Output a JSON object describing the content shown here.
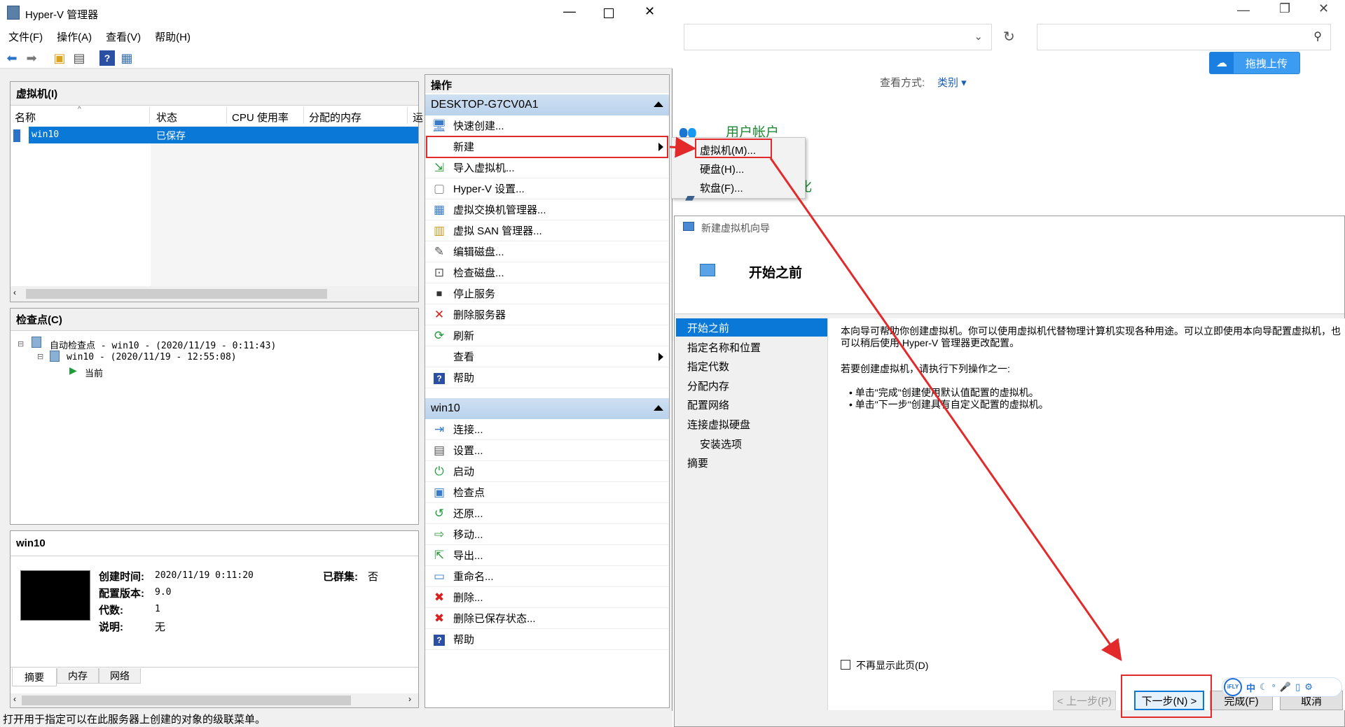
{
  "colors": {
    "selection": "#0a78d7",
    "annotation_red": "#e32a2a",
    "section_bar": "#c7dcf1",
    "upload_blue": "#3b9cf2"
  },
  "hyperv": {
    "title": "Hyper-V 管理器",
    "menu": [
      "文件(F)",
      "操作(A)",
      "查看(V)",
      "帮助(H)"
    ],
    "vm_panel": {
      "header": "虚拟机(I)",
      "columns": [
        "名称",
        "状态",
        "CPU 使用率",
        "分配的内存",
        "运"
      ],
      "rows": [
        {
          "name": "win10",
          "state": "已保存"
        }
      ]
    },
    "checkpoint_panel": {
      "header": "检查点(C)",
      "items": [
        "自动检查点 - win10 - (2020/11/19 - 0:11:43)",
        "win10 - (2020/11/19 - 12:55:08)",
        "当前"
      ]
    },
    "details_panel": {
      "header": "win10",
      "created_label": "创建时间:",
      "created_value": "2020/11/19 0:11:20",
      "clustered_label": "已群集:",
      "clustered_value": "否",
      "config_label": "配置版本:",
      "config_value": "9.0",
      "gen_label": "代数:",
      "gen_value": "1",
      "note_label": "说明:",
      "note_value": "无",
      "tabs": [
        "摘要",
        "内存",
        "网络"
      ]
    },
    "status_bar": "打开用于指定可以在此服务器上创建的对象的级联菜单。"
  },
  "actions": {
    "header": "操作",
    "host_section": "DESKTOP-G7CV0A1",
    "host_items": [
      "快速创建...",
      "新建",
      "导入虚拟机...",
      "Hyper-V 设置...",
      "虚拟交换机管理器...",
      "虚拟 SAN 管理器...",
      "编辑磁盘...",
      "检查磁盘...",
      "停止服务",
      "删除服务器",
      "刷新",
      "查看",
      "帮助"
    ],
    "vm_section": "win10",
    "vm_items": [
      "连接...",
      "设置...",
      "启动",
      "检查点",
      "还原...",
      "移动...",
      "导出...",
      "重命名...",
      "删除...",
      "删除已保存状态...",
      "帮助"
    ]
  },
  "submenu": {
    "items": [
      "虚拟机(M)...",
      "硬盘(H)...",
      "软盘(F)..."
    ]
  },
  "control_panel": {
    "view_label": "查看方式:",
    "view_value": "类别",
    "user_accounts": "用户帐户",
    "partial_text": "化",
    "upload_button": "拖拽上传"
  },
  "wizard": {
    "title": "新建虚拟机向导",
    "heading": "开始之前",
    "nav": [
      "开始之前",
      "指定名称和位置",
      "指定代数",
      "分配内存",
      "配置网络",
      "连接虚拟硬盘",
      "安装选项",
      "摘要"
    ],
    "intro": "本向导可帮助你创建虚拟机。你可以使用虚拟机代替物理计算机实现各种用途。可以立即使用本向导配置虚拟机，也可以稍后使用 Hyper-V 管理器更改配置。",
    "choose": "若要创建虚拟机，请执行下列操作之一:",
    "bullet1": "单击\"完成\"创建使用默认值配置的虚拟机。",
    "bullet2": "单击\"下一步\"创建具有自定义配置的虚拟机。",
    "dont_show": "不再显示此页(D)",
    "buttons": {
      "prev": "< 上一步(P)",
      "next": "下一步(N) >",
      "finish": "完成(F)",
      "cancel": "取消"
    }
  },
  "ime": {
    "items": [
      "iFLY",
      "中"
    ]
  }
}
